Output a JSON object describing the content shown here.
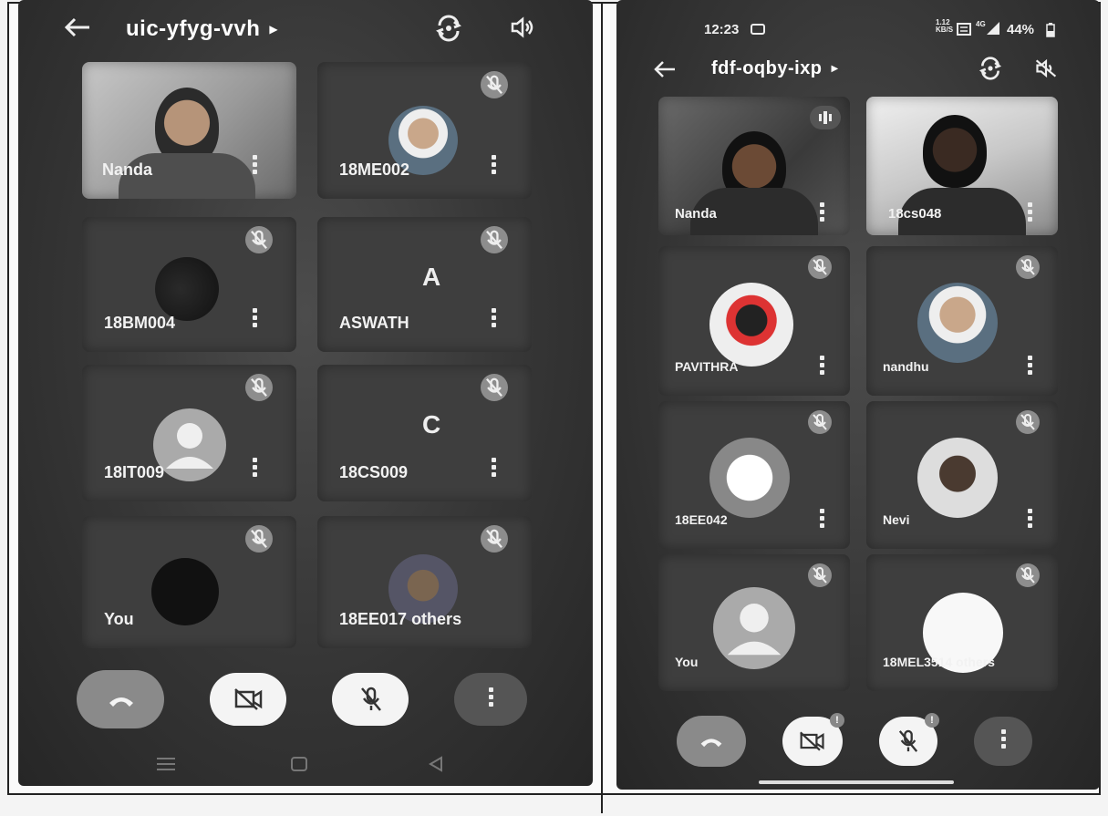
{
  "left_screen": {
    "meeting_code": "uic-yfyg-vvh",
    "tiles": [
      {
        "name": "Nanda",
        "avatar": "camera-video-woman"
      },
      {
        "name": "18ME002",
        "avatar": "photo-man"
      },
      {
        "name": "18BM004",
        "avatar": "dark-photo"
      },
      {
        "name": "ASWATH",
        "avatar": "letter",
        "letter": "A"
      },
      {
        "name": "18IT009",
        "avatar": "default-person"
      },
      {
        "name": "18CS009",
        "avatar": "letter",
        "letter": "C"
      },
      {
        "name": "You",
        "avatar": "black-circle"
      },
      {
        "name": "18EE017 others",
        "avatar": "photo-person"
      }
    ],
    "nav_icons": [
      "menu-lines",
      "home-square",
      "back-triangle"
    ]
  },
  "right_screen": {
    "status_time": "12:23",
    "status_speed": "1.12 KB/S",
    "status_network": "4G",
    "status_battery": "44%",
    "meeting_code": "fdf-oqby-ixp",
    "tiles": [
      {
        "name": "Nanda",
        "avatar": "camera-video-woman-headset"
      },
      {
        "name": "18cs048",
        "avatar": "camera-video-man"
      },
      {
        "name": "PAVITHRA",
        "avatar": "mickey-photo"
      },
      {
        "name": "nandhu",
        "avatar": "photo-man"
      },
      {
        "name": "18EE042",
        "avatar": "text-photo"
      },
      {
        "name": "Nevi",
        "avatar": "photo-girl"
      },
      {
        "name": "You",
        "avatar": "default-person"
      },
      {
        "name": "18MEL3514 others",
        "avatar": "white-circle"
      }
    ]
  },
  "colors": {
    "background": "#353535",
    "tile": "#3e3e3e",
    "end_call": "#8a8a8a",
    "control_white": "#f4f4f4",
    "badge": "#8d8d8d"
  }
}
